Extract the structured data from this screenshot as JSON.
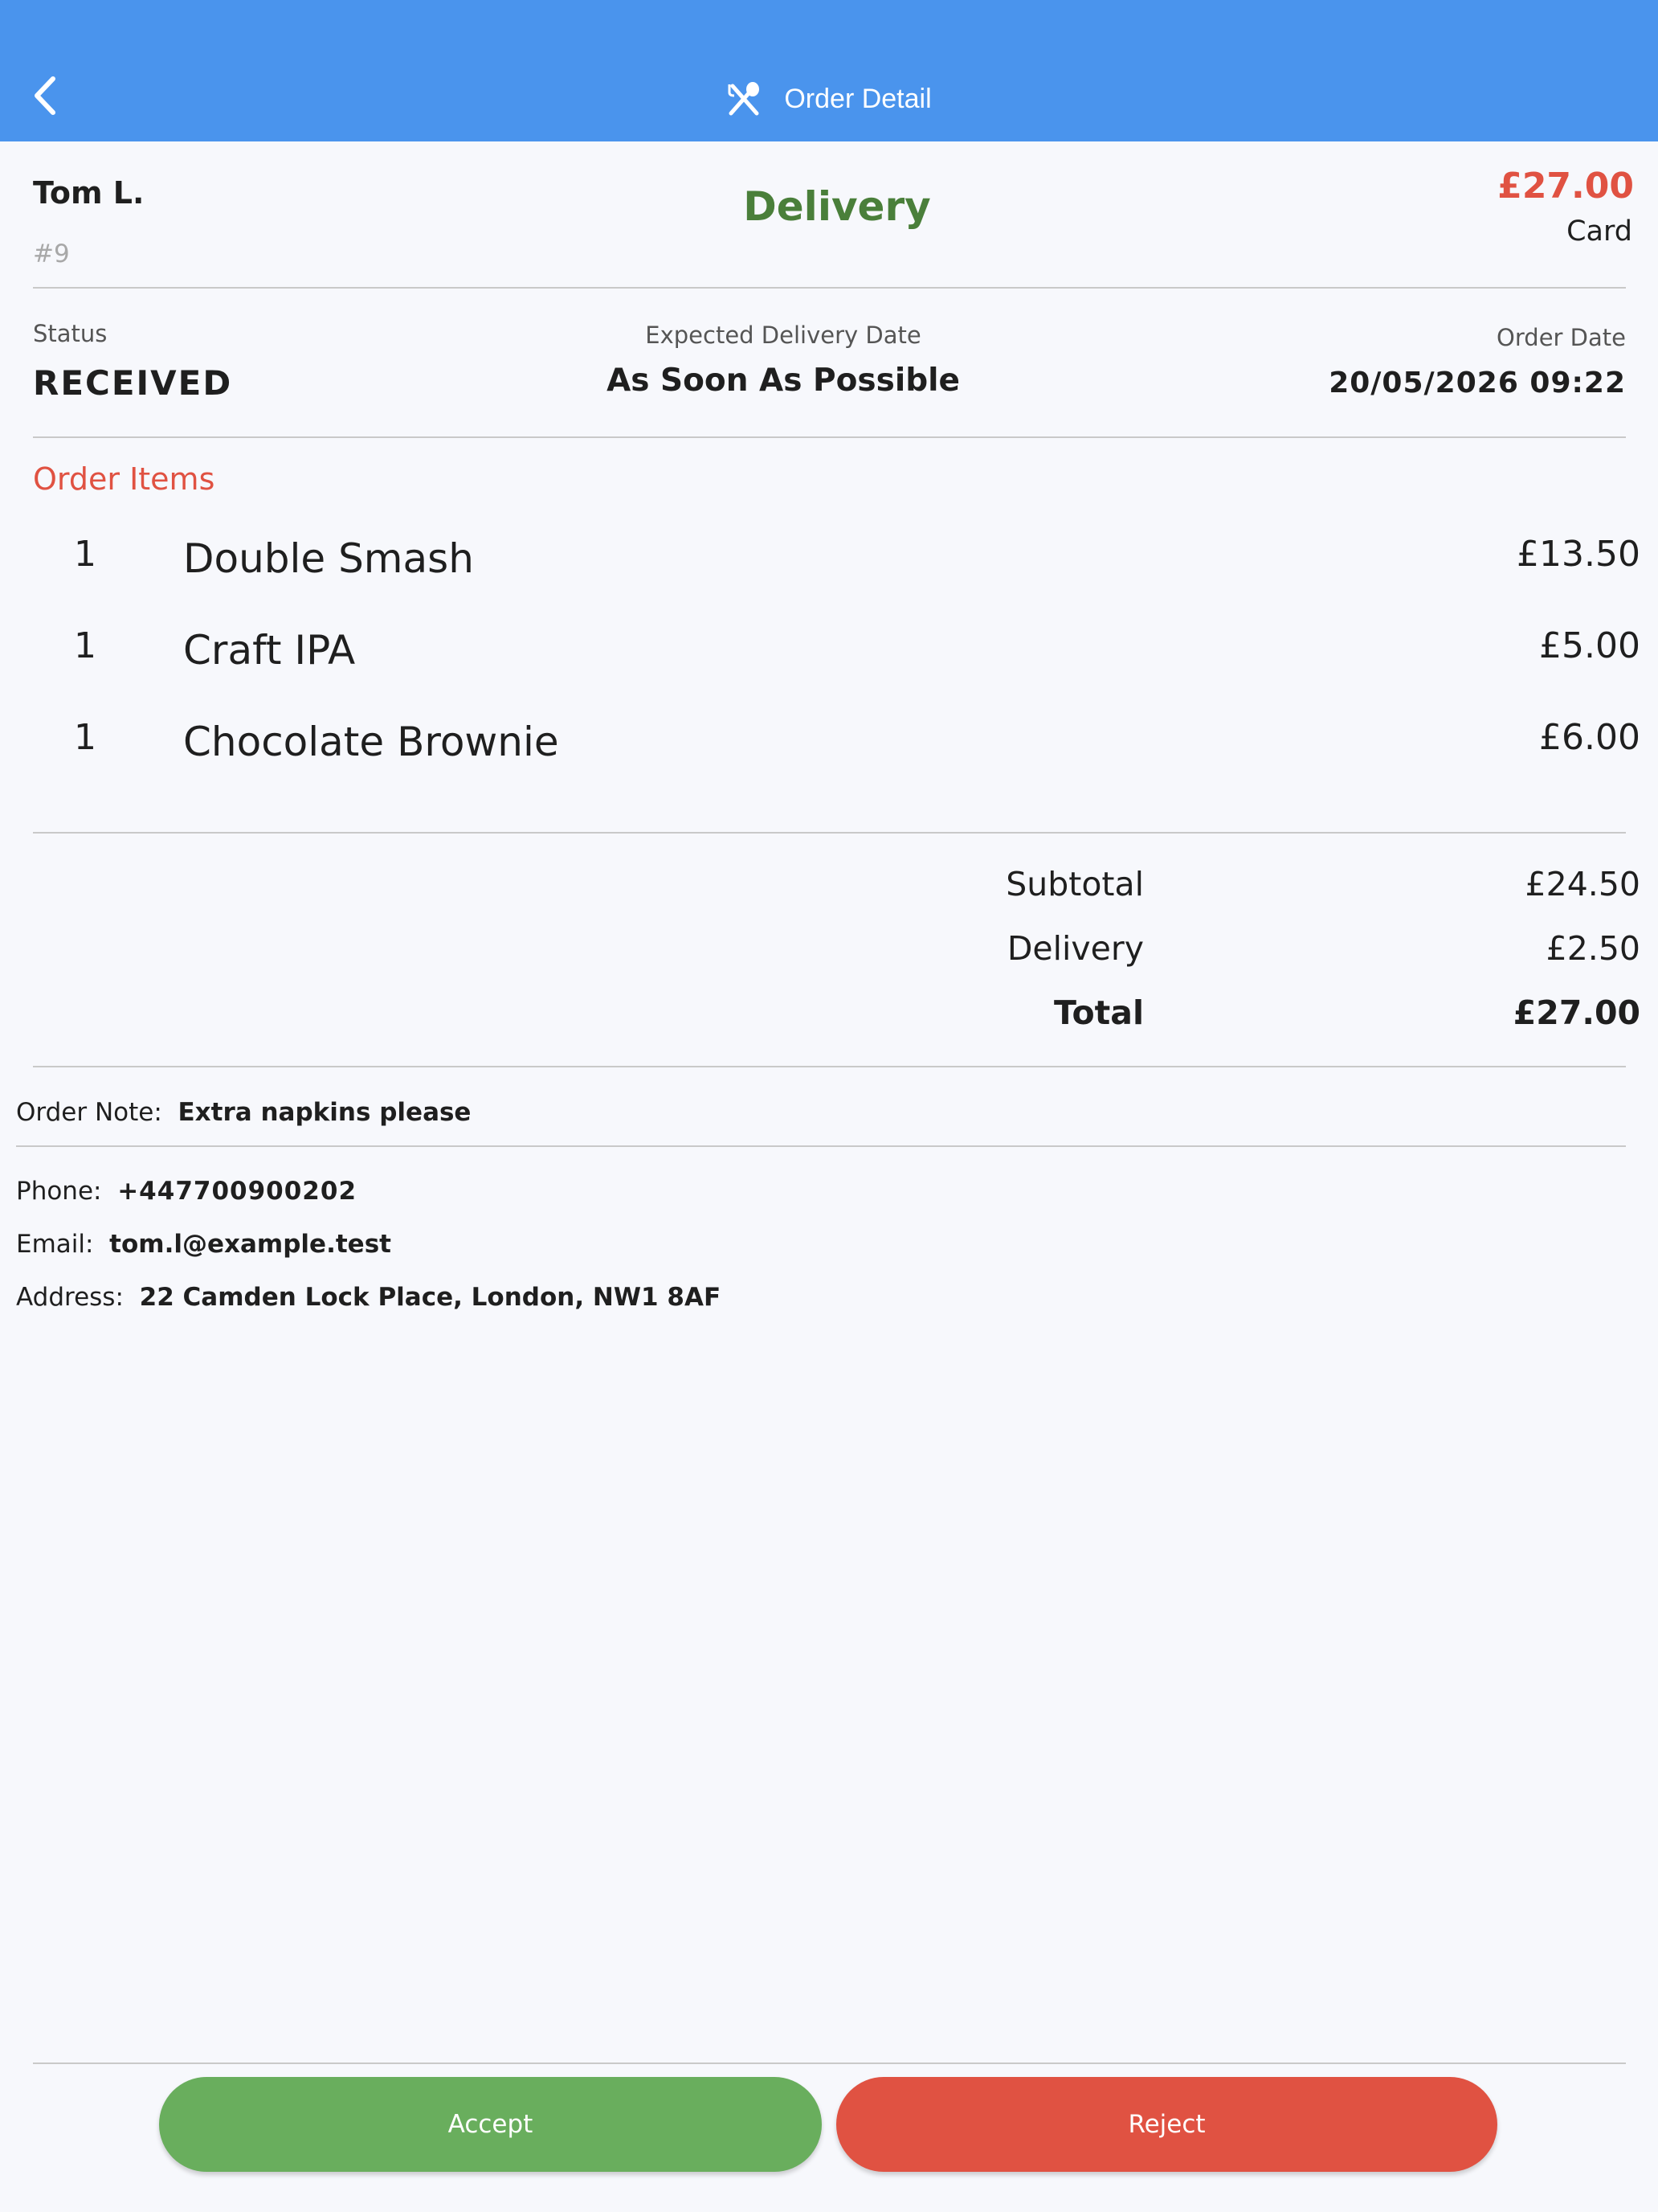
{
  "header": {
    "title": "Order Detail",
    "back_icon": "chevron-left-icon",
    "title_icon": "fork-spoon-icon",
    "background": "#4A94ED"
  },
  "order": {
    "customer_name": "Tom L.",
    "order_number": "#9",
    "order_type": "Delivery",
    "total_amount": "£27.00",
    "payment_method": "Card"
  },
  "meta": {
    "status_label": "Status",
    "status_value": "RECEIVED",
    "expected_label": "Expected Delivery Date",
    "expected_value": "As Soon As Possible",
    "order_date_label": "Order Date",
    "order_date_value": "20/05/2026 09:22"
  },
  "items_title": "Order Items",
  "items": [
    {
      "qty": "1",
      "name": "Double Smash",
      "price": "£13.50"
    },
    {
      "qty": "1",
      "name": "Craft IPA",
      "price": "£5.00"
    },
    {
      "qty": "1",
      "name": "Chocolate Brownie",
      "price": "£6.00"
    }
  ],
  "totals": {
    "subtotal_label": "Subtotal",
    "subtotal_value": "£24.50",
    "delivery_label": "Delivery",
    "delivery_value": "£2.50",
    "total_label": "Total",
    "total_value": "£27.00"
  },
  "note": {
    "label": "Order Note:",
    "value": "Extra napkins please"
  },
  "contact": {
    "phone_label": "Phone:",
    "phone_value": "+447700900202",
    "email_label": "Email:",
    "email_value": "tom.l@example.test",
    "address_label": "Address:",
    "address_value": "22 Camden Lock Place, London, NW1 8AF"
  },
  "actions": {
    "accept_label": "Accept",
    "reject_label": "Reject",
    "accept_color": "#69AE5D",
    "reject_color": "#E05242"
  },
  "colors": {
    "accent_red": "#E05242",
    "delivery_green": "#4A7F3A",
    "muted_gray": "#9E9E9E"
  }
}
